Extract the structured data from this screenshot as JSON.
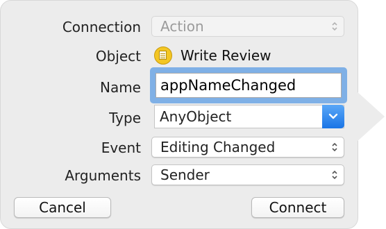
{
  "labels": {
    "connection": "Connection",
    "object": "Object",
    "name": "Name",
    "type": "Type",
    "event": "Event",
    "arguments": "Arguments"
  },
  "connection": {
    "value": "Action",
    "disabled": true
  },
  "object": {
    "value": "Write Review",
    "icon": "document-icon"
  },
  "name": {
    "value": "appNameChanged"
  },
  "type": {
    "value": "AnyObject",
    "icon": "chevron-down-icon"
  },
  "event": {
    "value": "Editing Changed"
  },
  "arguments": {
    "value": "Sender"
  },
  "buttons": {
    "cancel": "Cancel",
    "connect": "Connect"
  },
  "colors": {
    "panel": "#ececec",
    "focus_ring": "#7fb0e6",
    "accent": "#1a75e6",
    "object_icon": "#f3c623"
  }
}
